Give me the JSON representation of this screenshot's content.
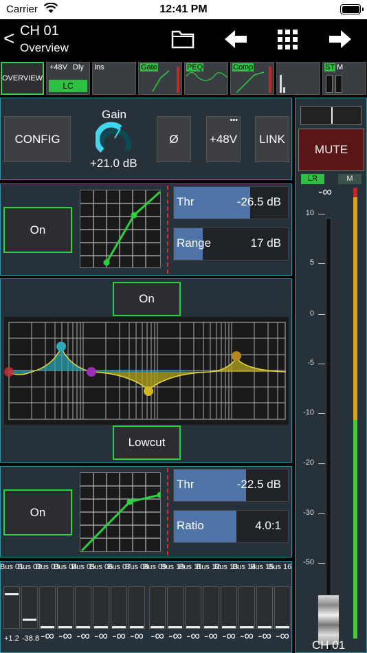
{
  "status": {
    "carrier": "Carrier",
    "time": "12:41 PM"
  },
  "header": {
    "title": "CH 01",
    "subtitle": "Overview"
  },
  "tabs": {
    "overview": "OVERVIEW",
    "phantom": "+48V",
    "delay": "Dly",
    "lowcut": "LC",
    "insert": "Ins",
    "gate": "Gate",
    "peq": "PEQ",
    "comp": "Comp",
    "st": "ST",
    "m": "M"
  },
  "input": {
    "config": "CONFIG",
    "gain_label": "Gain",
    "gain_value": "+21.0 dB",
    "phase": "Ø",
    "phantom": "+48V",
    "more": "•••",
    "link": "LINK"
  },
  "gate": {
    "on": "On",
    "thr_label": "Thr",
    "thr_value": "-26.5 dB",
    "thr_fill": 0.67,
    "range_label": "Range",
    "range_value": "17 dB",
    "range_fill": 0.25
  },
  "eq": {
    "on": "On",
    "lowcut": "Lowcut"
  },
  "comp": {
    "on": "On",
    "thr_label": "Thr",
    "thr_value": "-22.5 dB",
    "thr_fill": 0.63,
    "ratio_label": "Ratio",
    "ratio_value": "4.0:1",
    "ratio_fill": 0.55
  },
  "fader": {
    "mute": "MUTE",
    "lr": "LR",
    "m": "M",
    "level": "-∞",
    "scale": [
      "10",
      "5",
      "0",
      "-5",
      "-10",
      "-20",
      "-30",
      "-50"
    ],
    "channel": "CH 01"
  },
  "buses": {
    "labels": [
      "Bus 01",
      "Bus 02",
      "Bus 03",
      "Bus 04",
      "Bus 05",
      "Bus 06",
      "Bus 07",
      "Bus 08",
      "Bus 09",
      "Bus 10",
      "Bus 11",
      "Bus 12",
      "Bus 13",
      "Bus 14",
      "Bus 15",
      "Bus 16"
    ],
    "values": [
      "+1.2",
      "-38.8",
      "-∞",
      "-∞",
      "-∞",
      "-∞",
      "-∞",
      "-∞",
      "-∞",
      "-∞",
      "-∞",
      "-∞",
      "-∞",
      "-∞",
      "-∞",
      "-∞"
    ],
    "levels": [
      0.85,
      0.2,
      0,
      0,
      0,
      0,
      0,
      0,
      0,
      0,
      0,
      0,
      0,
      0,
      0,
      0
    ]
  },
  "colors": {
    "accent_green": "#27d33e",
    "panel_border": "#2f95a8",
    "param_fill": "#4f74a8",
    "mute": "#5a1616"
  }
}
